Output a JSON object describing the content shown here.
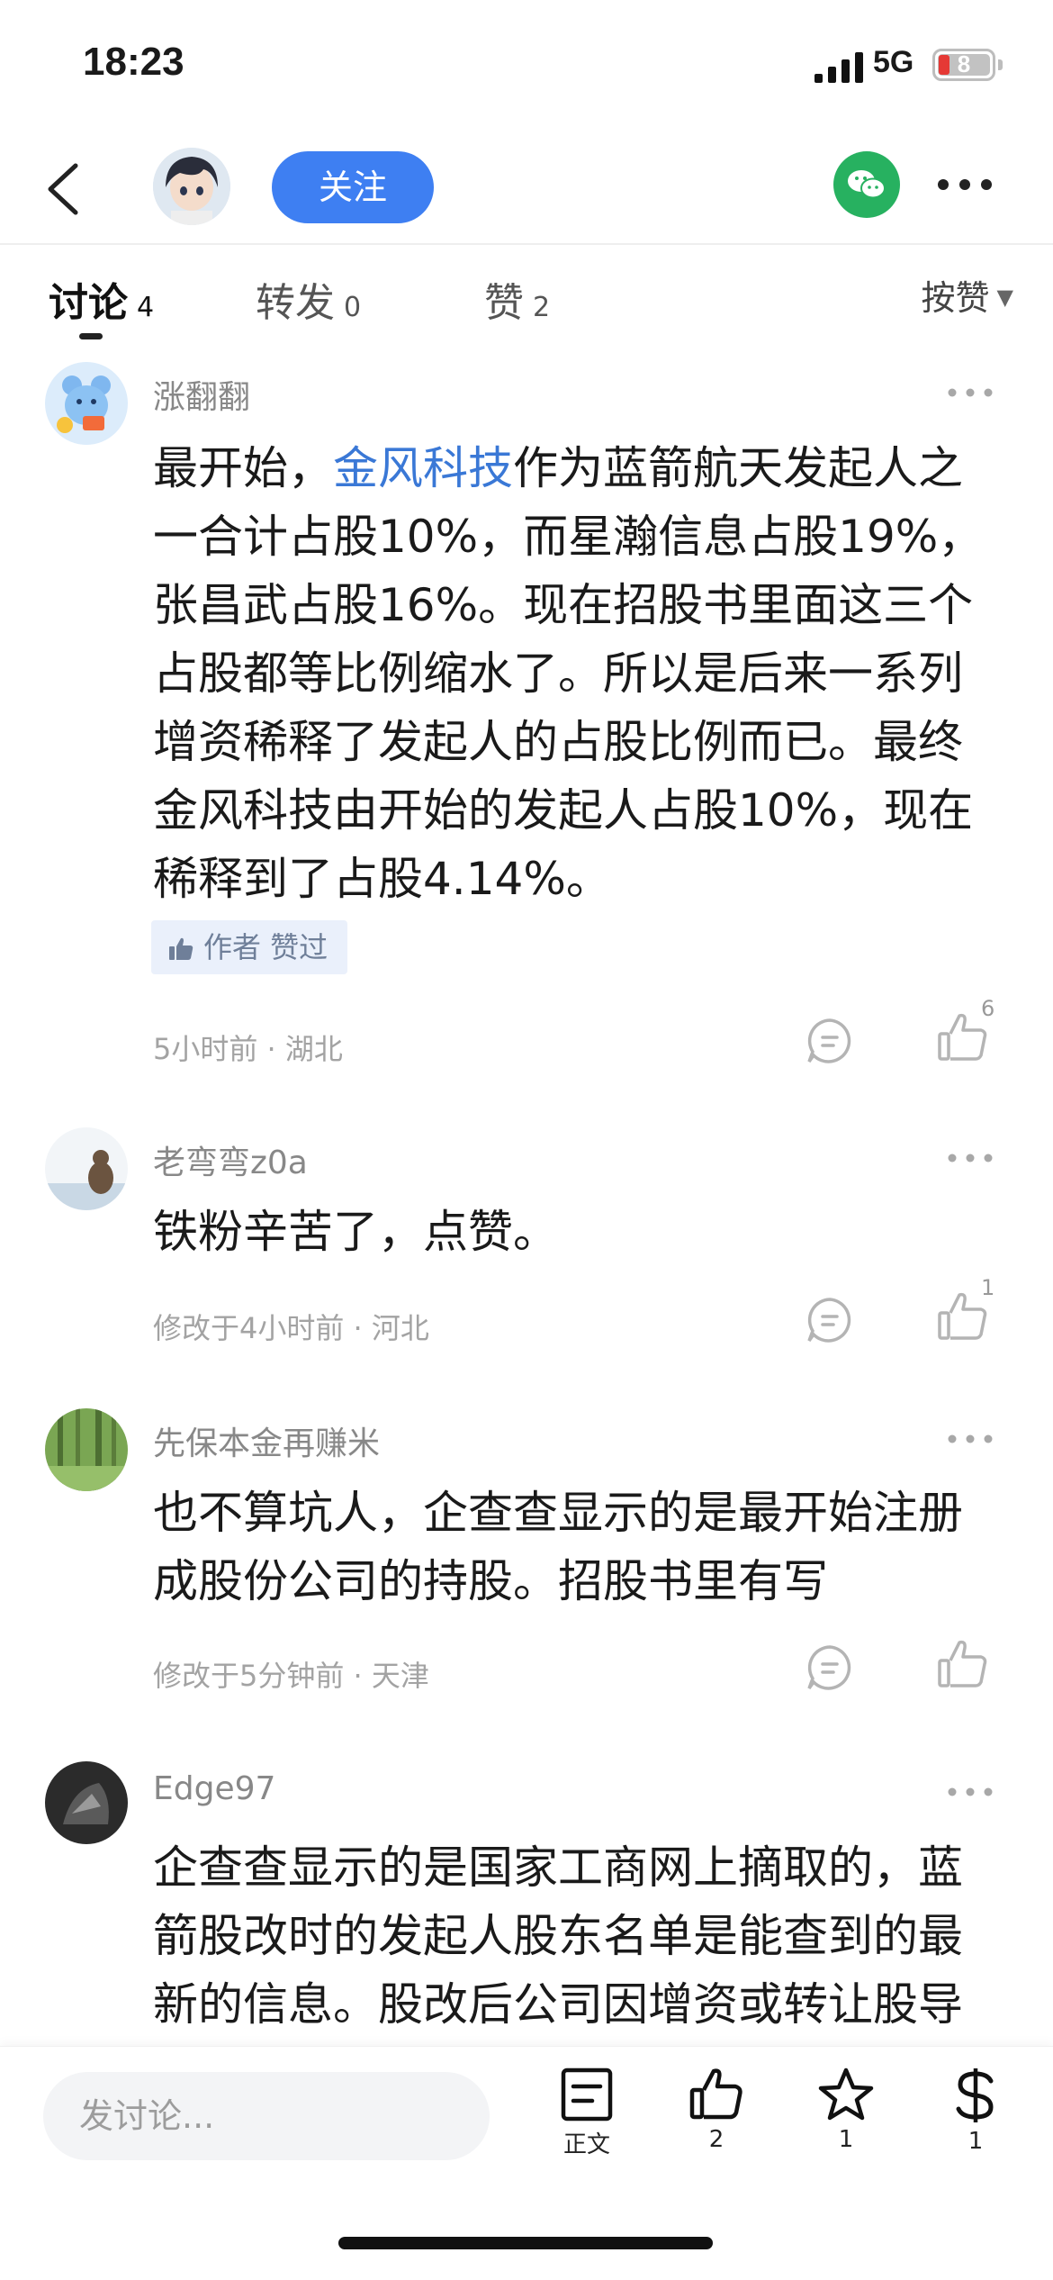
{
  "status_bar": {
    "time": "18:23",
    "network": "5G",
    "battery": "8"
  },
  "nav": {
    "follow_label": "关注",
    "icons": [
      "back-icon",
      "wechat-icon",
      "more-icon"
    ]
  },
  "tabs": [
    {
      "label": "讨论",
      "count": "4",
      "active": true
    },
    {
      "label": "转发",
      "count": "0",
      "active": false
    },
    {
      "label": "赞",
      "count": "2",
      "active": false
    }
  ],
  "sort_label": "按赞",
  "comments": [
    {
      "user": "涨翻翻",
      "body_pre": "最开始，",
      "body_link": "金风科技",
      "body_post": "作为蓝箭航天发起人之一合计占股10%，而星瀚信息占股19%，张昌武占股16%。现在招股书里面这三个占股都等比例缩水了。所以是后来一系列增资稀释了发起人的占股比例而已。最终金风科技由开始的发起人占股10%，现在稀释到了占股4.14%。",
      "badge": "作者 赞过",
      "meta": "5小时前 · 湖北",
      "likes": "6"
    },
    {
      "user": "老弯弯z0a",
      "body": "铁粉辛苦了，点赞。",
      "meta": "修改于4小时前 · 河北",
      "likes": "1"
    },
    {
      "user": "先保本金再赚米",
      "body": "也不算坑人，企查查显示的是最开始注册成股份公司的持股。招股书里有写",
      "meta": "修改于5分钟前 · 天津",
      "likes": ""
    },
    {
      "user": "Edge97",
      "body": "企查查显示的是国家工商网上摘取的，蓝箭股改时的发起人股东名单是能查到的最新的信息。股改后公司因增资或转让股导致股东结构变化等，需要查阅"
    }
  ],
  "bottom_bar": {
    "input_placeholder": "发讨论...",
    "text_label": "正文",
    "like_count": "2",
    "fav_count": "1",
    "reward_count": "1"
  },
  "colors": {
    "accent": "#3e7ff2",
    "link": "#3a78d6",
    "wechat": "#27b160"
  }
}
